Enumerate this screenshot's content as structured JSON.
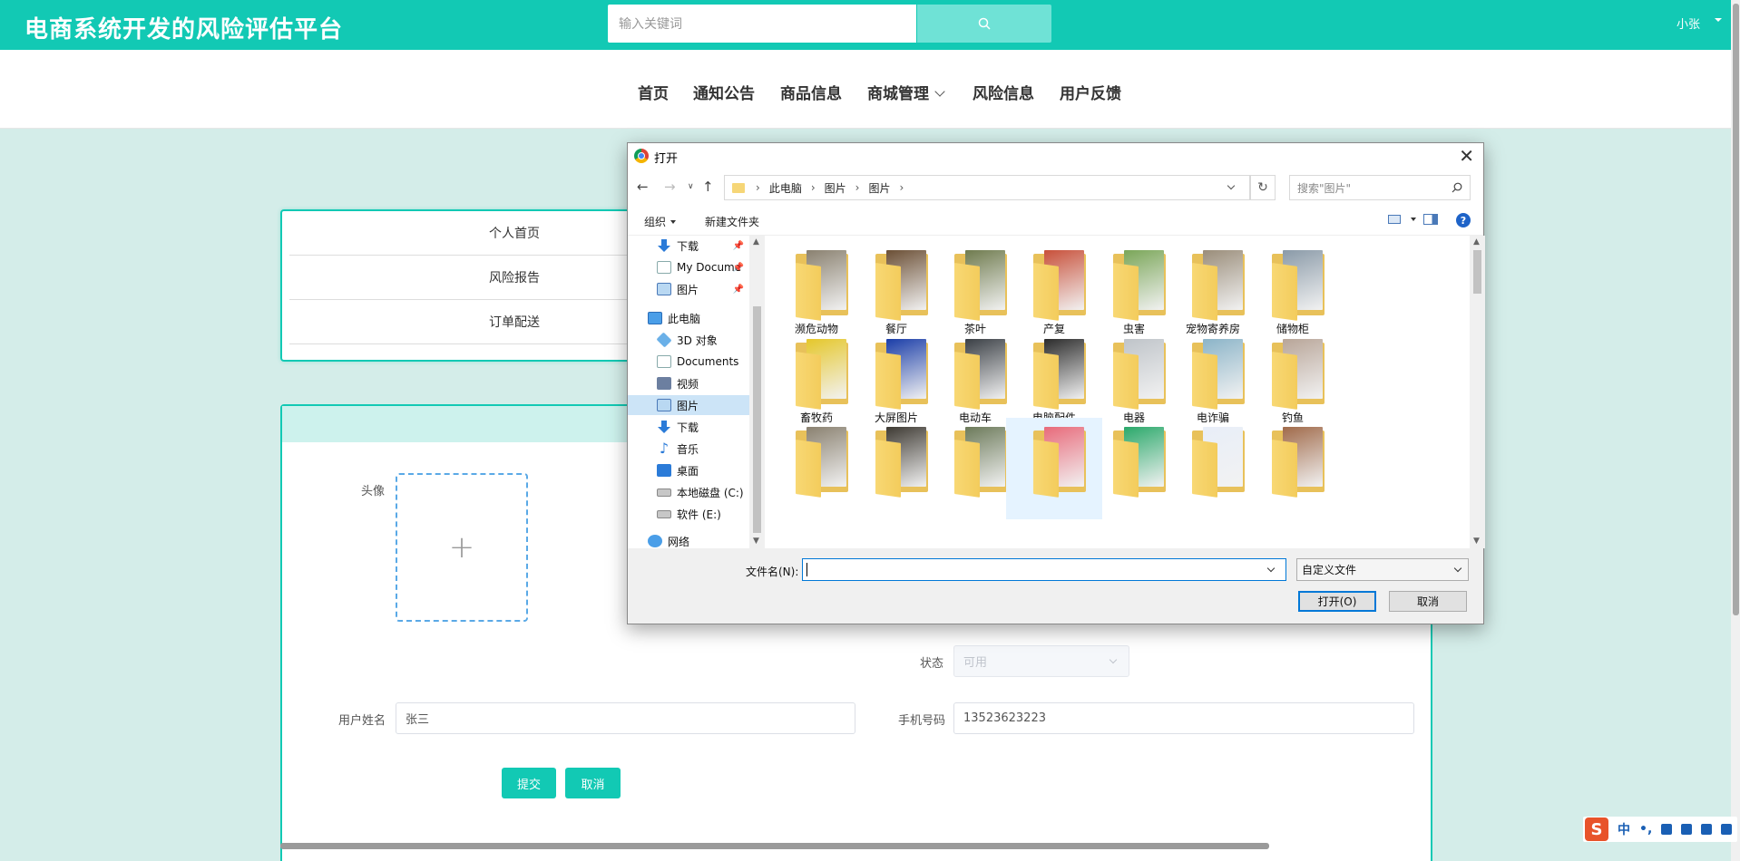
{
  "header": {
    "site_title": "电商系统开发的风险评估平台",
    "search_placeholder": "输入关键词",
    "user_name": "小张"
  },
  "nav": {
    "items": [
      "首页",
      "通知公告",
      "商品信息",
      "商城管理",
      "风险信息",
      "用户反馈"
    ]
  },
  "side_menu": {
    "items": [
      "个人首页",
      "风险报告",
      "订单配送"
    ]
  },
  "form": {
    "avatar_label": "头像",
    "avatar_plus": "+",
    "status_label": "状态",
    "status_value": "可用",
    "username_label": "用户姓名",
    "username_value": "张三",
    "phone_label": "手机号码",
    "phone_value": "13523623223",
    "submit_label": "提交",
    "cancel_label": "取消"
  },
  "dialog": {
    "title": "打开",
    "close": "✕",
    "breadcrumb": [
      "此电脑",
      "图片",
      "图片"
    ],
    "refresh": "↻",
    "search_placeholder": "搜索\"图片\"",
    "toolbar": {
      "organize": "组织",
      "new_folder": "新建文件夹",
      "help": "?"
    },
    "tree": [
      {
        "label": "下载",
        "icon": "download-icon",
        "pinned": true
      },
      {
        "label": "My Docume",
        "icon": "document-icon",
        "pinned": true
      },
      {
        "label": "图片",
        "icon": "pictures-icon",
        "pinned": true
      },
      {
        "label": "此电脑",
        "icon": "computer-icon",
        "pinned": false
      },
      {
        "label": "3D 对象",
        "icon": "3d-objects-icon",
        "pinned": false
      },
      {
        "label": "Documents",
        "icon": "document-icon",
        "pinned": false
      },
      {
        "label": "视频",
        "icon": "video-icon",
        "pinned": false
      },
      {
        "label": "图片",
        "icon": "pictures-icon",
        "pinned": false,
        "selected": true
      },
      {
        "label": "下载",
        "icon": "download-icon",
        "pinned": false
      },
      {
        "label": "音乐",
        "icon": "music-icon",
        "pinned": false
      },
      {
        "label": "桌面",
        "icon": "desktop-icon",
        "pinned": false
      },
      {
        "label": "本地磁盘 (C:)",
        "icon": "disk-icon",
        "pinned": false
      },
      {
        "label": "软件 (E:)",
        "icon": "disk-icon",
        "pinned": false
      },
      {
        "label": "网络",
        "icon": "network-icon",
        "pinned": false
      }
    ],
    "folders": [
      {
        "name": "濒危动物",
        "color": "#8a8170"
      },
      {
        "name": "餐厅",
        "color": "#6b4f35"
      },
      {
        "name": "茶叶",
        "color": "#6f7b4e"
      },
      {
        "name": "产复",
        "color": "#c8503a"
      },
      {
        "name": "虫害",
        "color": "#7aa658"
      },
      {
        "name": "宠物寄养房",
        "color": "#9a8d7a"
      },
      {
        "name": "储物柜",
        "color": "#8a9aa8"
      },
      {
        "name": "畜牧药",
        "color": "#e5c72a"
      },
      {
        "name": "大屏图片",
        "color": "#1a3da8"
      },
      {
        "name": "电动车",
        "color": "#3a3f45"
      },
      {
        "name": "电脑配件",
        "color": "#2b2b2b"
      },
      {
        "name": "电器",
        "color": "#bfc4c9"
      },
      {
        "name": "电诈骗",
        "color": "#8bb4c8"
      },
      {
        "name": "钓鱼",
        "color": "#b8a598"
      },
      {
        "name": "",
        "color": "#8a8170"
      },
      {
        "name": "",
        "color": "#3e3a33"
      },
      {
        "name": "",
        "color": "#6c7a5a"
      },
      {
        "name": "",
        "color": "#e86a7a"
      },
      {
        "name": "",
        "color": "#2aa86a"
      },
      {
        "name": "",
        "color": "#e8eef8"
      },
      {
        "name": "",
        "color": "#a06a4a"
      }
    ],
    "filename_label": "文件名(N):",
    "filename_value": "",
    "filetype": "自定义文件",
    "open_button": "打开(O)",
    "cancel_button": "取消"
  },
  "ime": {
    "logo": "S",
    "mode": "中",
    "punct": "•,"
  }
}
